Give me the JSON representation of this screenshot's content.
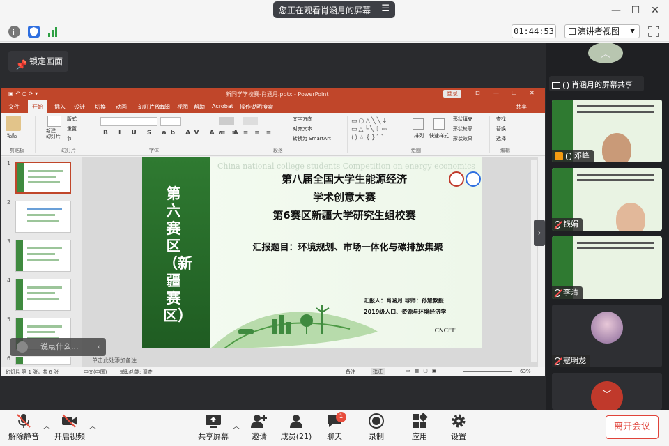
{
  "app": {
    "share_banner": "您正在观看肖涵月的屏幕",
    "timer": "01:44:53",
    "view_mode": "演讲者视图",
    "lock_screen": "锁定画面",
    "chat_placeholder": "说点什么..."
  },
  "ppt": {
    "title": "新同学学校赛-肖涵月.pptx - PowerPoint",
    "login": "登录",
    "share": "共享",
    "tabs": [
      "文件",
      "开始",
      "插入",
      "设计",
      "切换",
      "动画",
      "幻灯片放映",
      "审阅",
      "视图",
      "帮助",
      "Acrobat",
      "操作说明搜索"
    ],
    "groups": [
      "剪贴板",
      "幻灯片",
      "字体",
      "段落",
      "绘图",
      "编辑"
    ],
    "ribbon_items": {
      "paste": "粘贴",
      "new_slide": "新建\n幻灯片",
      "layout": "版式",
      "reset": "重置",
      "section": "节",
      "text_direction": "文字方向",
      "align_text": "对齐文本",
      "smartart": "转换为 SmartArt",
      "arrange": "排列",
      "quick_styles": "快速样式",
      "shape_fill": "形状填充",
      "shape_outline": "形状轮廓",
      "shape_effects": "形状效果",
      "find": "查找",
      "replace": "替换",
      "select": "选择"
    },
    "thumb_numbers": [
      "1",
      "2",
      "3",
      "4",
      "5",
      "6"
    ],
    "notes": "单击此处添加备注",
    "status_left": "幻灯片 第 1 张，共 6 张",
    "status_lang": "中文(中国)",
    "status_access": "辅助功能: 调查",
    "status_notes": "备注",
    "status_comments": "批注",
    "zoom": "63%"
  },
  "slide": {
    "vertical_title": "第六赛区（新疆赛区）",
    "bg_text": "China national college students Competition on energy economics",
    "line1": "第八届全国大学生能源经济",
    "line2": "学术创意大赛",
    "line3": "第6赛区新疆大学研究生组校赛",
    "topic": "汇报题目：环境规划、市场一体化与碳排放集聚",
    "reporter": "汇报人：肖涵月   导师：孙慧教授",
    "class": "2019级人口、资源与环境经济学",
    "logo": "CNCEE"
  },
  "participants": [
    {
      "name": "肖涵月的屏幕共享"
    },
    {
      "name": "邓峰"
    },
    {
      "name": "钱娟"
    },
    {
      "name": "李清"
    },
    {
      "name": "寇明龙"
    }
  ],
  "controls": {
    "mute": "解除静音",
    "video": "开启视频",
    "share": "共享屏幕",
    "invite": "邀请",
    "members": "成员(21)",
    "chat": "聊天",
    "chat_badge": "1",
    "record": "录制",
    "apps": "应用",
    "settings": "设置",
    "leave": "离开会议"
  },
  "colors": {
    "ppt_accent": "#c0462a",
    "slide_green": "#2f7a31",
    "leave_red": "#e0433a",
    "stage_dark": "#2a2b2e"
  }
}
